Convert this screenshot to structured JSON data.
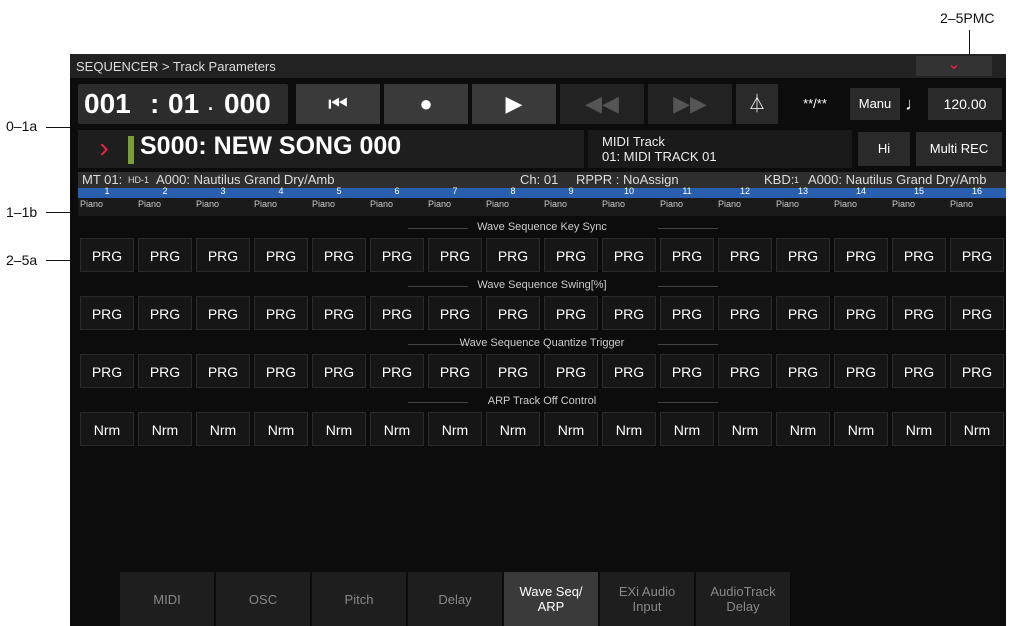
{
  "callouts": {
    "top_right": "2–5PMC",
    "left_a": "0–1a",
    "left_b": "1–1b",
    "left_c": "2–5a"
  },
  "title": "SEQUENCER > Track Parameters",
  "expand_icon": "chevron-down-icon",
  "time": {
    "measure": "001",
    "sep1": ":",
    "beat": "01",
    "sep2": ".",
    "tick": "000"
  },
  "meter": "**/**",
  "manu": "Manu",
  "note_glyph": "♩",
  "tempo": "120.00",
  "song": {
    "name": "S000: NEW SONG 000"
  },
  "midi_track": {
    "line1": "MIDI Track",
    "line2": "01: MIDI TRACK 01"
  },
  "hi_label": "Hi",
  "multi_rec_label": "Multi REC",
  "info": {
    "mt": "MT 01:",
    "hd": "HD-1",
    "program": "A000: Nautilus Grand Dry/Amb",
    "ch": "Ch: 01",
    "rppr": "RPPR : NoAssign",
    "kbd": "KBD:",
    "kbd_num": "1",
    "kbd_program": "A000: Nautilus Grand Dry/Amb"
  },
  "track_numbers": [
    "1",
    "2",
    "3",
    "4",
    "5",
    "6",
    "7",
    "8",
    "9",
    "10",
    "11",
    "12",
    "13",
    "14",
    "15",
    "16"
  ],
  "track_names": [
    "Piano",
    "Piano",
    "Piano",
    "Piano",
    "Piano",
    "Piano",
    "Piano",
    "Piano",
    "Piano",
    "Piano",
    "Piano",
    "Piano",
    "Piano",
    "Piano",
    "Piano",
    "Piano"
  ],
  "sections": [
    {
      "label": "Wave Sequence Key Sync",
      "values": [
        "PRG",
        "PRG",
        "PRG",
        "PRG",
        "PRG",
        "PRG",
        "PRG",
        "PRG",
        "PRG",
        "PRG",
        "PRG",
        "PRG",
        "PRG",
        "PRG",
        "PRG",
        "PRG"
      ]
    },
    {
      "label": "Wave Sequence Swing[%]",
      "values": [
        "PRG",
        "PRG",
        "PRG",
        "PRG",
        "PRG",
        "PRG",
        "PRG",
        "PRG",
        "PRG",
        "PRG",
        "PRG",
        "PRG",
        "PRG",
        "PRG",
        "PRG",
        "PRG"
      ]
    },
    {
      "label": "Wave Sequence Quantize Trigger",
      "values": [
        "PRG",
        "PRG",
        "PRG",
        "PRG",
        "PRG",
        "PRG",
        "PRG",
        "PRG",
        "PRG",
        "PRG",
        "PRG",
        "PRG",
        "PRG",
        "PRG",
        "PRG",
        "PRG"
      ]
    },
    {
      "label": "ARP Track Off Control",
      "values": [
        "Nrm",
        "Nrm",
        "Nrm",
        "Nrm",
        "Nrm",
        "Nrm",
        "Nrm",
        "Nrm",
        "Nrm",
        "Nrm",
        "Nrm",
        "Nrm",
        "Nrm",
        "Nrm",
        "Nrm",
        "Nrm"
      ]
    }
  ],
  "tabs": [
    {
      "line1": "MIDI",
      "line2": ""
    },
    {
      "line1": "OSC",
      "line2": ""
    },
    {
      "line1": "Pitch",
      "line2": ""
    },
    {
      "line1": "Delay",
      "line2": ""
    },
    {
      "line1": "Wave Seq/",
      "line2": "ARP"
    },
    {
      "line1": "EXi Audio",
      "line2": "Input"
    },
    {
      "line1": "AudioTrack",
      "line2": "Delay"
    }
  ],
  "active_tab": 4
}
